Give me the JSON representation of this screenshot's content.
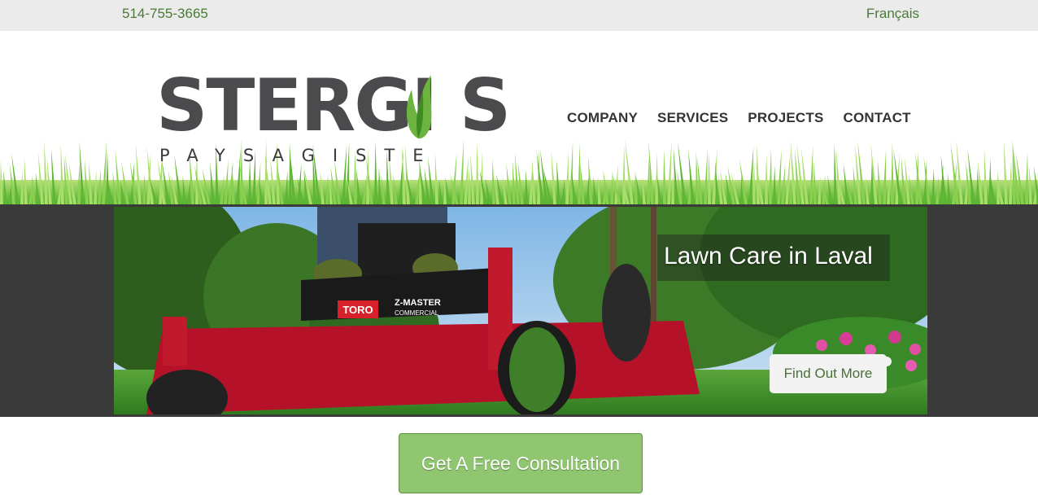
{
  "topbar": {
    "phone": "514-755-3665",
    "language": "Français"
  },
  "logo": {
    "word": "STERGI S",
    "subtitle": "PAYSAGISTE"
  },
  "nav": {
    "items": [
      "COMPANY",
      "SERVICES",
      "PROJECTS",
      "CONTACT"
    ]
  },
  "slider": {
    "caption": "Lawn Care in Laval",
    "button": "Find Out More",
    "mower_brand": "TORO",
    "mower_model": "Z-MASTER",
    "mower_sub": "COMMERCIAL"
  },
  "cta": {
    "label": "Get A Free Consultation"
  },
  "colors": {
    "accent_green": "#8fc66f",
    "link_green": "#4a7a36",
    "logo_gray": "#4b4b4d"
  }
}
